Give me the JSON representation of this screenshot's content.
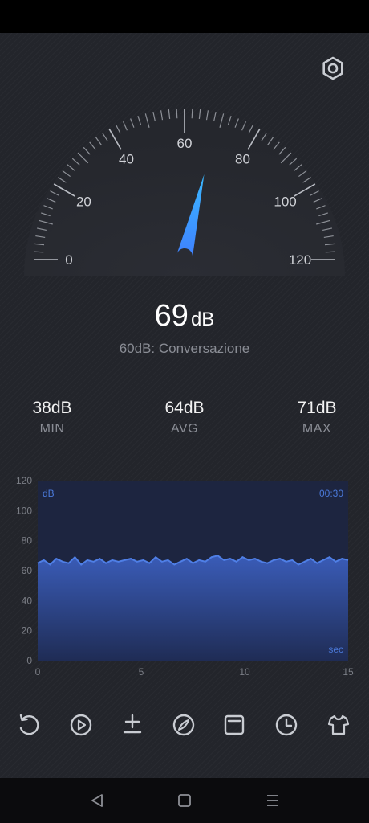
{
  "gauge": {
    "labels": [
      "0",
      "20",
      "40",
      "60",
      "80",
      "100",
      "120"
    ],
    "min": 0,
    "max": 120,
    "value": 69
  },
  "reading": {
    "value": "69",
    "unit": "dB"
  },
  "description": "60dB: Conversazione",
  "stats": {
    "min": {
      "value": "38dB",
      "label": "MIN"
    },
    "avg": {
      "value": "64dB",
      "label": "AVG"
    },
    "max": {
      "value": "71dB",
      "label": "MAX"
    }
  },
  "chart_data": {
    "type": "area",
    "y_ticks": [
      "120",
      "100",
      "80",
      "60",
      "40",
      "20",
      "0"
    ],
    "x_ticks": [
      "0",
      "5",
      "10",
      "15"
    ],
    "ylim": [
      0,
      120
    ],
    "xlim": [
      0,
      15
    ],
    "unit_label": "dB",
    "time_label": "00:30",
    "sec_label": "sec",
    "x": [
      0,
      0.3,
      0.6,
      0.9,
      1.2,
      1.5,
      1.8,
      2.1,
      2.4,
      2.7,
      3.0,
      3.3,
      3.6,
      3.9,
      4.2,
      4.5,
      4.8,
      5.1,
      5.4,
      5.7,
      6.0,
      6.3,
      6.6,
      6.9,
      7.2,
      7.5,
      7.8,
      8.1,
      8.4,
      8.7,
      9.0,
      9.3,
      9.6,
      9.9,
      10.2,
      10.5,
      10.8,
      11.1,
      11.4,
      11.7,
      12.0,
      12.3,
      12.6,
      12.9,
      13.2,
      13.5,
      13.8,
      14.1,
      14.4,
      14.7,
      15.0
    ],
    "values": [
      65,
      67,
      64,
      68,
      66,
      65,
      69,
      64,
      67,
      66,
      68,
      65,
      67,
      66,
      67,
      68,
      66,
      67,
      65,
      69,
      66,
      67,
      64,
      66,
      68,
      65,
      67,
      66,
      69,
      70,
      67,
      68,
      66,
      69,
      67,
      68,
      66,
      65,
      67,
      68,
      66,
      67,
      64,
      66,
      68,
      65,
      67,
      69,
      66,
      68,
      67
    ],
    "color": "#4f7fe6"
  },
  "toolbar": {
    "icons": [
      "reset-icon",
      "play-icon",
      "calibrate-icon",
      "compass-icon",
      "save-icon",
      "history-icon",
      "theme-icon"
    ]
  },
  "navbar": {
    "icons": [
      "back-icon",
      "home-icon",
      "menu-icon"
    ]
  }
}
